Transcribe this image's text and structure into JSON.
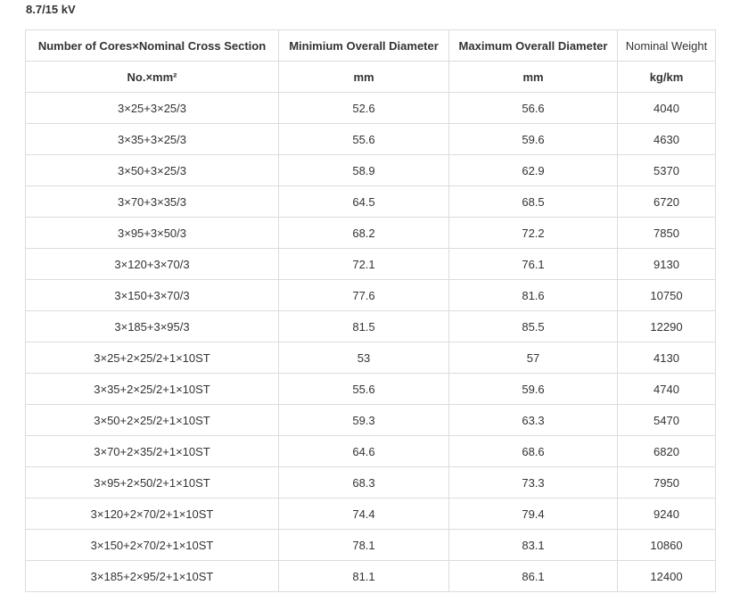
{
  "heading": "8.7/15 kV",
  "table": {
    "headers": [
      "Number of Cores×Nominal Cross Section",
      "Minimium Overall Diameter",
      "Maximum Overall Diameter",
      "Nominal Weight"
    ],
    "units": [
      "No.×mm²",
      "mm",
      "mm",
      "kg/km"
    ],
    "rows": [
      [
        "3×25+3×25/3",
        "52.6",
        "56.6",
        "4040"
      ],
      [
        "3×35+3×25/3",
        "55.6",
        "59.6",
        "4630"
      ],
      [
        "3×50+3×25/3",
        "58.9",
        "62.9",
        "5370"
      ],
      [
        "3×70+3×35/3",
        "64.5",
        "68.5",
        "6720"
      ],
      [
        "3×95+3×50/3",
        "68.2",
        "72.2",
        "7850"
      ],
      [
        "3×120+3×70/3",
        "72.1",
        "76.1",
        "9130"
      ],
      [
        "3×150+3×70/3",
        "77.6",
        "81.6",
        "10750"
      ],
      [
        "3×185+3×95/3",
        "81.5",
        "85.5",
        "12290"
      ],
      [
        "3×25+2×25/2+1×10ST",
        "53",
        "57",
        "4130"
      ],
      [
        "3×35+2×25/2+1×10ST",
        "55.6",
        "59.6",
        "4740"
      ],
      [
        "3×50+2×25/2+1×10ST",
        "59.3",
        "63.3",
        "5470"
      ],
      [
        "3×70+2×35/2+1×10ST",
        "64.6",
        "68.6",
        "6820"
      ],
      [
        "3×95+2×50/2+1×10ST",
        "68.3",
        "73.3",
        "7950"
      ],
      [
        "3×120+2×70/2+1×10ST",
        "74.4",
        "79.4",
        "9240"
      ],
      [
        "3×150+2×70/2+1×10ST",
        "78.1",
        "83.1",
        "10860"
      ],
      [
        "3×185+2×95/2+1×10ST",
        "81.1",
        "86.1",
        "12400"
      ]
    ]
  }
}
